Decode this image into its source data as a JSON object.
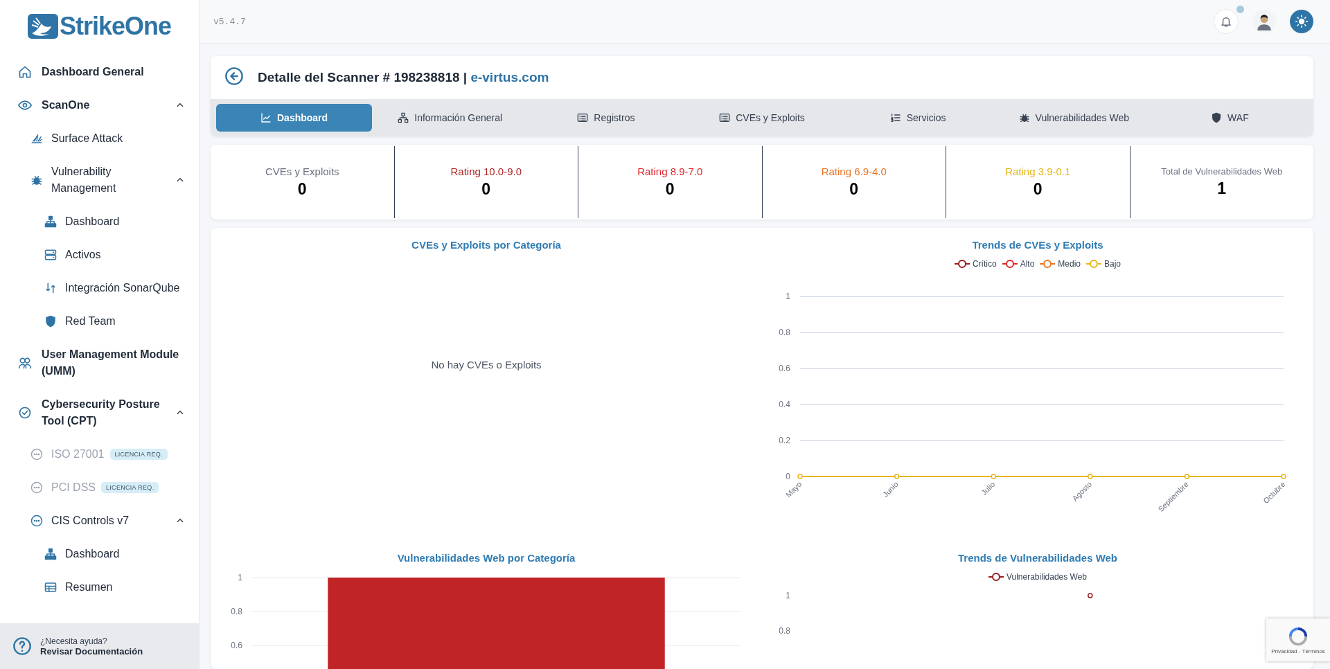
{
  "sidebar": {
    "logo": "StrikeOne",
    "items": [
      {
        "label": "Dashboard General"
      },
      {
        "label": "ScanOne",
        "expanded": true,
        "children": [
          {
            "label": "Surface Attack"
          },
          {
            "label": "Vulnerability Management",
            "expanded": true,
            "children": [
              {
                "label": "Dashboard"
              },
              {
                "label": "Activos"
              },
              {
                "label": "Integración SonarQube"
              },
              {
                "label": "Red Team"
              }
            ]
          }
        ]
      },
      {
        "label": "User Management Module (UMM)"
      },
      {
        "label": "Cybersecurity Posture Tool (CPT)",
        "expanded": true,
        "children": [
          {
            "label": "ISO 27001",
            "disabled": true,
            "badge": "LICENCIA REQ."
          },
          {
            "label": "PCI DSS",
            "disabled": true,
            "badge": "LICENCIA REQ."
          },
          {
            "label": "CIS Controls v7",
            "disabled": false,
            "expanded": true,
            "children": [
              {
                "label": "Dashboard"
              },
              {
                "label": "Resumen"
              }
            ]
          }
        ]
      }
    ],
    "help": {
      "question": "¿Necesita ayuda?",
      "link": "Revisar Documentación"
    }
  },
  "header": {
    "version": "v5.4.7"
  },
  "scanner": {
    "title": "Detalle del Scanner # 198238818 |",
    "domain": "e-virtus.com"
  },
  "tabs": [
    {
      "label": "Dashboard",
      "selected": true
    },
    {
      "label": "Información General",
      "selected": false
    },
    {
      "label": "Registros",
      "selected": false
    },
    {
      "label": "CVEs y Exploits",
      "selected": false
    },
    {
      "label": "Servicios",
      "selected": false
    },
    {
      "label": "Vulnerabilidades Web",
      "selected": false
    },
    {
      "label": "WAF",
      "selected": false
    }
  ],
  "stats": [
    {
      "label": "CVEs y Exploits",
      "value": "0",
      "color": "#6b7280"
    },
    {
      "label": "Rating 10.0-9.0",
      "value": "0",
      "color": "#b32626"
    },
    {
      "label": "Rating 8.9-7.0",
      "value": "0",
      "color": "#e0262b"
    },
    {
      "label": "Rating 6.9-4.0",
      "value": "0",
      "color": "#ec7424"
    },
    {
      "label": "Rating 3.9-0.1",
      "value": "0",
      "color": "#e8b51c"
    },
    {
      "label": "Total de Vulnerabilidades Web",
      "value": "1",
      "color": "#6b7280"
    }
  ],
  "charts": [
    {
      "kind": "empty",
      "title": "CVEs y Exploits por Categoría",
      "message": "No hay CVEs o Exploits"
    },
    {
      "kind": "chart",
      "title": "Trends de CVEs y Exploits",
      "chart_data": {
        "type": "line",
        "grid": true,
        "categories": [
          "Mayo",
          "Junio",
          "Julio",
          "Agosto",
          "Septiembre",
          "Octubre"
        ],
        "ylim": [
          0,
          1
        ],
        "yticks": [
          0,
          0.2,
          0.4,
          0.6,
          0.8,
          1
        ],
        "series": [
          {
            "name": "Crítico",
            "color": "#9b1c1c",
            "marker": true,
            "values": [
              null,
              null,
              null,
              null,
              null,
              null
            ]
          },
          {
            "name": "Alto",
            "color": "#e0262b",
            "marker": true,
            "values": [
              null,
              null,
              null,
              null,
              null,
              null
            ]
          },
          {
            "name": "Medio",
            "color": "#ec7424",
            "marker": true,
            "values": [
              null,
              null,
              null,
              null,
              null,
              null
            ]
          },
          {
            "name": "Bajo",
            "color": "#e8b51c",
            "marker": true,
            "values": [
              0,
              0,
              0,
              0,
              0,
              0
            ]
          }
        ]
      }
    },
    {
      "kind": "chart",
      "title": "Vulnerabilidades Web por Categoría",
      "chart_data": {
        "type": "bar",
        "grid": true,
        "ylim": [
          0,
          1
        ],
        "yticks": [
          0.6,
          0.8,
          1
        ],
        "series": [
          {
            "color": "#c02427",
            "values": [
              1
            ]
          }
        ]
      }
    },
    {
      "kind": "chart",
      "title": "Trends de Vulnerabilidades Web",
      "chart_data": {
        "type": "line",
        "ylim": [
          0.8,
          1
        ],
        "yticks": [
          0.8,
          1
        ],
        "series": [
          {
            "name": "Vulnerabilidades Web",
            "color": "#9b1c1c",
            "marker": true,
            "values": [
              null,
              null,
              null,
              1,
              null,
              null
            ]
          }
        ]
      }
    }
  ],
  "recaptcha": {
    "text": "Privacidad - Términos"
  }
}
